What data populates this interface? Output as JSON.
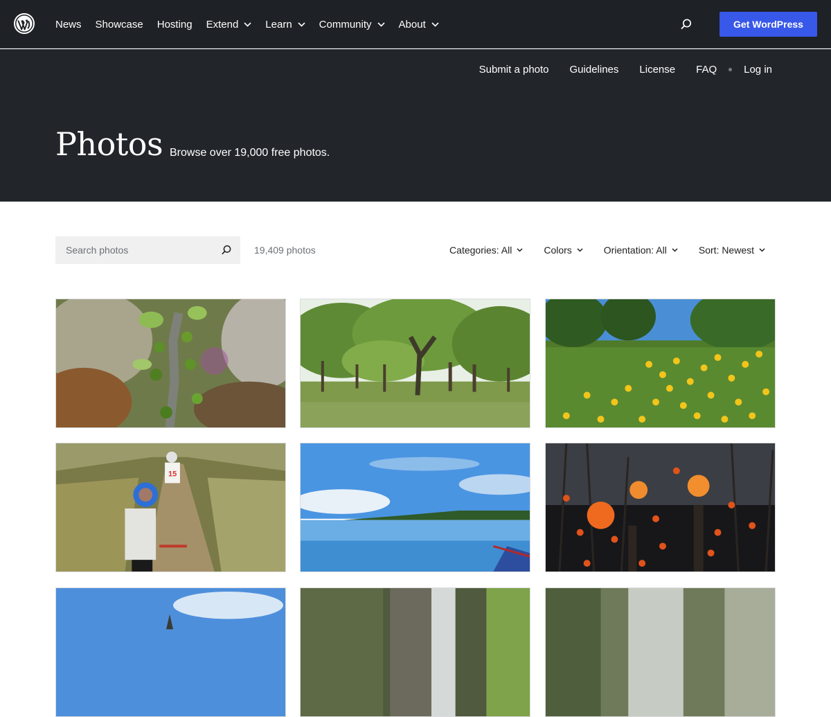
{
  "global_nav": {
    "logo_icon": "wordpress-logo-icon",
    "items": [
      {
        "label": "News",
        "has_dropdown": false
      },
      {
        "label": "Showcase",
        "has_dropdown": false
      },
      {
        "label": "Hosting",
        "has_dropdown": false
      },
      {
        "label": "Extend",
        "has_dropdown": true
      },
      {
        "label": "Learn",
        "has_dropdown": true
      },
      {
        "label": "Community",
        "has_dropdown": true
      },
      {
        "label": "About",
        "has_dropdown": true
      }
    ],
    "search_icon": "search-icon",
    "cta_label": "Get WordPress"
  },
  "local_nav": {
    "items": [
      "Submit a photo",
      "Guidelines",
      "License",
      "FAQ"
    ],
    "login_label": "Log in"
  },
  "hero": {
    "title": "Photos",
    "subtitle": "Browse over 19,000 free photos."
  },
  "search": {
    "placeholder": "Search photos",
    "value": ""
  },
  "results": {
    "count_label": "19,409 photos"
  },
  "filters": [
    {
      "label": "Categories: All"
    },
    {
      "label": "Colors"
    },
    {
      "label": "Orientation: All"
    },
    {
      "label": "Sort: Newest"
    }
  ],
  "photos": [
    {
      "subject": "fig-branch"
    },
    {
      "subject": "park-trees"
    },
    {
      "subject": "yellow-flowers"
    },
    {
      "subject": "kids-on-bikes"
    },
    {
      "subject": "lake-with-boat"
    },
    {
      "subject": "jack-o-lanterns"
    },
    {
      "subject": "sky-rooftop"
    },
    {
      "subject": "waterfall"
    },
    {
      "subject": "forest-waterfall"
    }
  ],
  "colors": {
    "topbar_bg": "#1e2125",
    "hero_bg": "#22262b",
    "accent": "#3858e9",
    "muted_text": "#6c7075",
    "search_bg": "#f0f0f1"
  }
}
